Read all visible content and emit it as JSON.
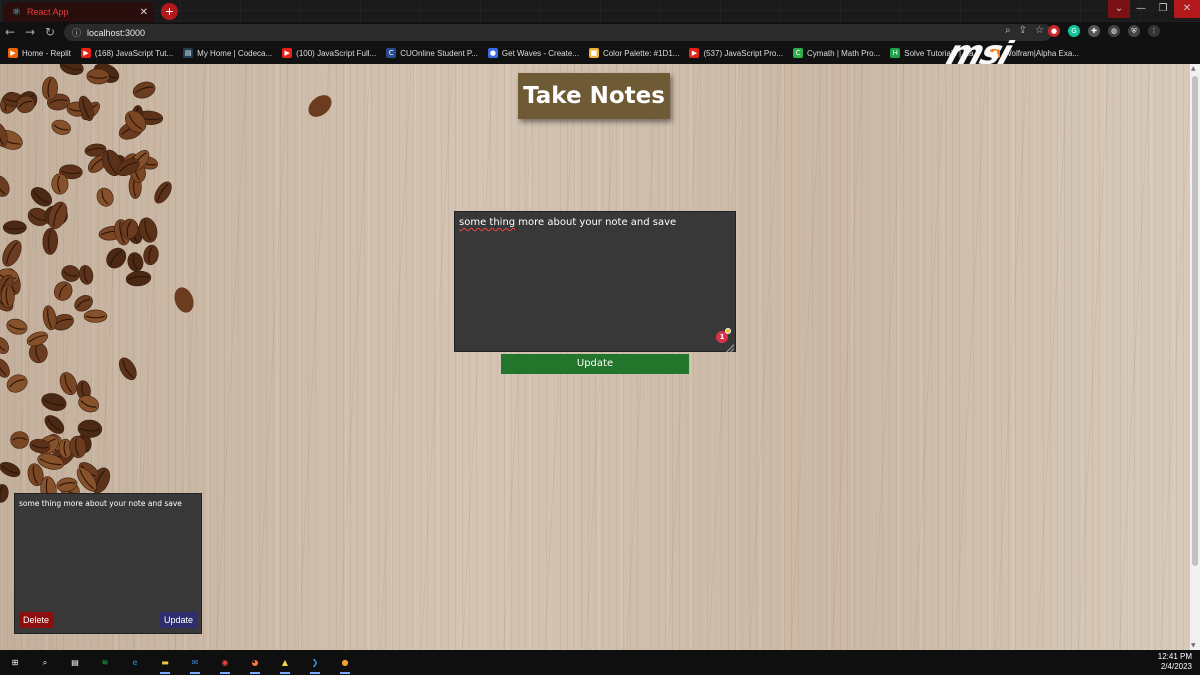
{
  "browser": {
    "tab_title": "React App",
    "new_tab_glyph": "+",
    "tab_close_glyph": "✕",
    "url": "localhost:3000",
    "back_glyph": "←",
    "forward_glyph": "→",
    "reload_glyph": "↻",
    "info_glyph": "ⓘ",
    "window_controls": [
      "⌄",
      "—",
      "❐",
      "✕"
    ]
  },
  "bookmarks": [
    {
      "label": "Home - Replit",
      "icon": "replit-icon",
      "color": "#f26207",
      "glyph": "▶"
    },
    {
      "label": "(168) JavaScript Tut...",
      "icon": "youtube-icon",
      "color": "#e62117",
      "glyph": "▶"
    },
    {
      "label": "My Home | Codeca...",
      "icon": "codecademy-icon",
      "color": "#1f4056",
      "glyph": "▤"
    },
    {
      "label": "(100) JavaScript Full...",
      "icon": "youtube-icon",
      "color": "#e62117",
      "glyph": "▶"
    },
    {
      "label": "CUOnline Student P...",
      "icon": "cuonline-icon",
      "color": "#2a4b8d",
      "glyph": "C"
    },
    {
      "label": "Get Waves - Create...",
      "icon": "waves-icon",
      "color": "#3b6ce8",
      "glyph": "●"
    },
    {
      "label": "Color Palette: #1D1...",
      "icon": "palette-icon",
      "color": "#f0b43a",
      "glyph": "■"
    },
    {
      "label": "(537) JavaScript Pro...",
      "icon": "youtube-icon",
      "color": "#e62117",
      "glyph": "▶"
    },
    {
      "label": "Cymath | Math Pro...",
      "icon": "cymath-icon",
      "color": "#2fae4a",
      "glyph": "C"
    },
    {
      "label": "Solve Tutorials | Ha...",
      "icon": "hackerrank-icon",
      "color": "#1fa34a",
      "glyph": "H"
    },
    {
      "label": "Wolfram|Alpha Exa...",
      "icon": "wolfram-icon",
      "color": "#f47c20",
      "glyph": "✹"
    }
  ],
  "brand": {
    "logo_text": "msi"
  },
  "page": {
    "title": "Take Notes",
    "editor_text_underlined": "some thing",
    "editor_text_rest": " more about your note and save",
    "update_label": "Update"
  },
  "note_card": {
    "text": "some thing more about your note and save",
    "delete_label": "Delete",
    "update_label": "Update"
  },
  "taskbar": {
    "apps": [
      {
        "name": "windows-start-icon",
        "color": "#ffffff",
        "glyph": "⊞"
      },
      {
        "name": "search-icon",
        "color": "#ffffff",
        "glyph": "⌕"
      },
      {
        "name": "task-view-icon",
        "color": "#ffffff",
        "glyph": "▤"
      },
      {
        "name": "spotify-icon",
        "color": "#1db954",
        "glyph": "≋"
      },
      {
        "name": "edge-icon",
        "color": "#2a8fd8",
        "glyph": "e"
      },
      {
        "name": "file-explorer-icon",
        "color": "#f5c542",
        "glyph": "▬"
      },
      {
        "name": "mail-icon",
        "color": "#3a86d4",
        "glyph": "✉"
      },
      {
        "name": "chrome-icon",
        "color": "#e8453c",
        "glyph": "◉"
      },
      {
        "name": "firefox-icon",
        "color": "#ff7139",
        "glyph": "◕"
      },
      {
        "name": "linux-icon",
        "color": "#f2d24b",
        "glyph": "▲"
      },
      {
        "name": "vscode-icon",
        "color": "#2a9df4",
        "glyph": "❯"
      },
      {
        "name": "app-orange-icon",
        "color": "#f4a12b",
        "glyph": "●"
      }
    ],
    "time": "12:41 PM",
    "date": "2/4/2023"
  },
  "colors": {
    "title_box": "#6e5a34",
    "editor_bg": "#383838",
    "update_green": "#22752a",
    "delete_red": "#8b0f0f",
    "update_navy": "#2e2e6e"
  }
}
